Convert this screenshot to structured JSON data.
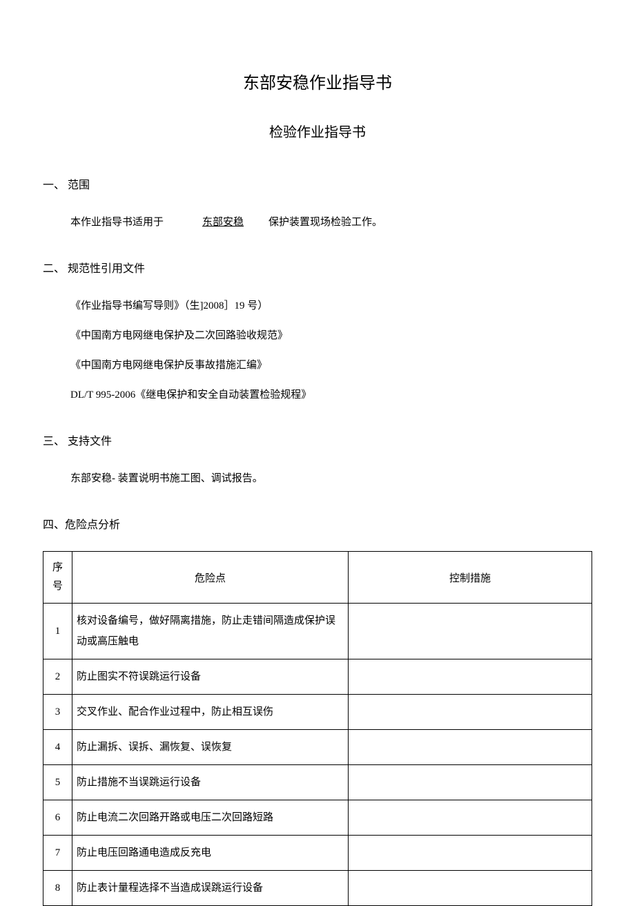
{
  "title": "东部安稳作业指导书",
  "subtitle": "检验作业指导书",
  "sections": {
    "scope": {
      "heading": "一、 范围",
      "prefix": "本作业指导书适用于",
      "underlined": "东部安稳",
      "suffix": "保护装置现场检验工作。"
    },
    "references": {
      "heading": "二、 规范性引用文件",
      "items": [
        "《作业指导书编写导则》（生]2008］19 号）",
        "《中国南方电网继电保护及二次回路验收规范》",
        "《中国南方电网继电保护反事故措施汇编》",
        "DL/T 995-2006《继电保护和安全自动装置检验规程》"
      ]
    },
    "support": {
      "heading": "三、 支持文件",
      "text": "东部安稳- 装置说明书施工图、调试报告。"
    },
    "risk": {
      "heading": "四、危险点分析",
      "table": {
        "headers": {
          "seq": "序号",
          "risk": "危险点",
          "measure": "控制措施"
        },
        "rows": [
          {
            "seq": "1",
            "risk": "核对设备编号，做好隔离措施，防止走错间隔造成保护误动或高压触电",
            "measure": ""
          },
          {
            "seq": "2",
            "risk": "防止图实不符误跳运行设备",
            "measure": ""
          },
          {
            "seq": "3",
            "risk": "交叉作业、配合作业过程中，防止相互误伤",
            "measure": ""
          },
          {
            "seq": "4",
            "risk": "防止漏拆、误拆、漏恢复、误恢复",
            "measure": ""
          },
          {
            "seq": "5",
            "risk": "防止措施不当误跳运行设备",
            "measure": ""
          },
          {
            "seq": "6",
            "risk": "防止电流二次回路开路或电压二次回路短路",
            "measure": ""
          },
          {
            "seq": "7",
            "risk": "防止电压回路通电造成反充电",
            "measure": ""
          },
          {
            "seq": "8",
            "risk": "防止表计量程选择不当造成误跳运行设备",
            "measure": ""
          }
        ]
      }
    }
  }
}
